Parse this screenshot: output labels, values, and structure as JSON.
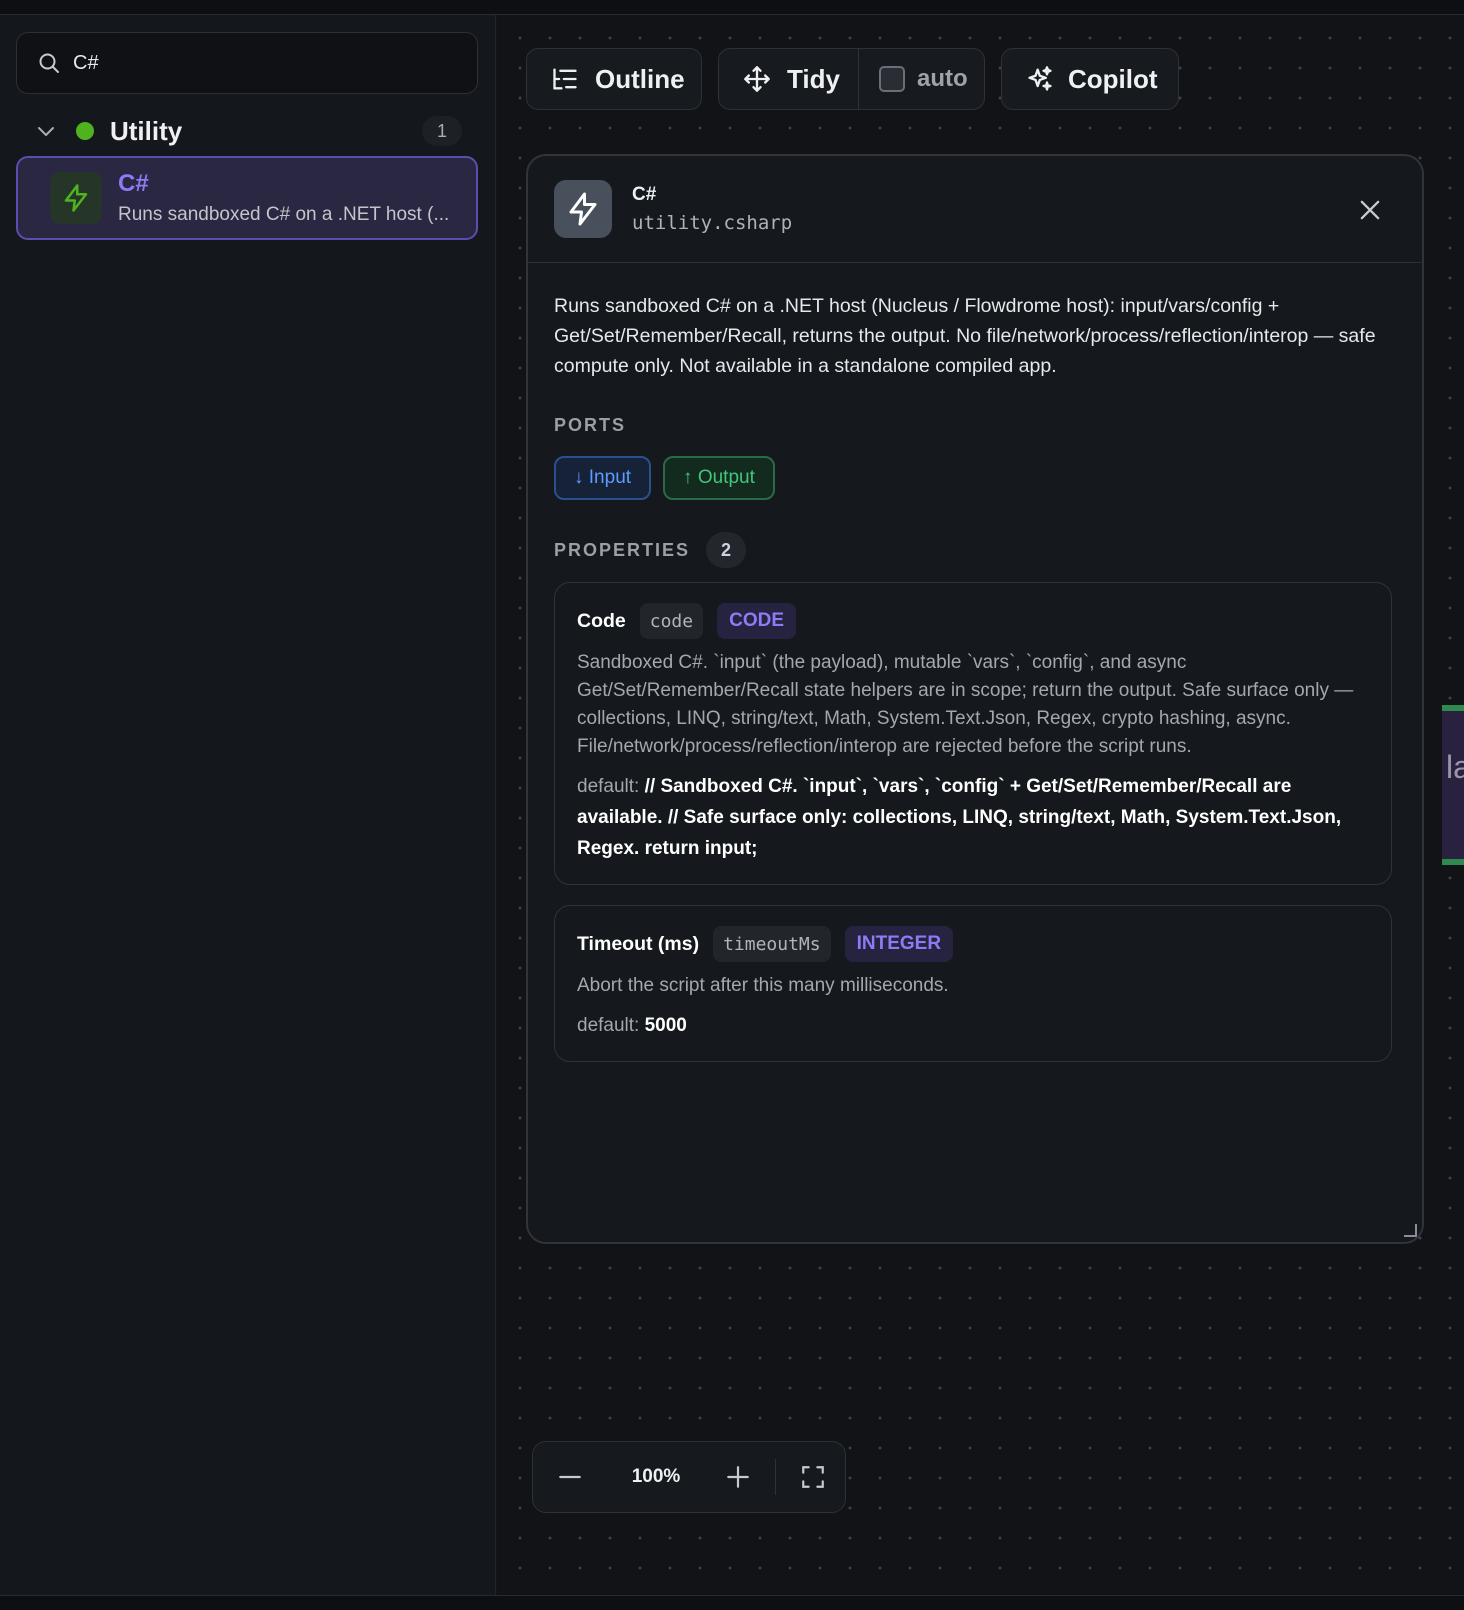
{
  "sidebar": {
    "search": {
      "value": "C#",
      "placeholder": ""
    },
    "group": {
      "label": "Utility",
      "count": "1",
      "status_color": "#4fb320"
    },
    "item": {
      "title": "C#",
      "description": "Runs sandboxed C# on a .NET host (..."
    }
  },
  "toolbar": {
    "outline_label": "Outline",
    "tidy_label": "Tidy",
    "auto_label": "auto",
    "auto_checked": false,
    "copilot_label": "Copilot"
  },
  "panel": {
    "title": "C#",
    "id": "utility.csharp",
    "description": "Runs sandboxed C# on a .NET host (Nucleus / Flowdrome host): input/vars/config + Get/Set/Remember/Recall, returns the output. No file/network/process/reflection/interop — safe compute only. Not available in a standalone compiled app.",
    "ports_label": "PORTS",
    "ports": {
      "input": "↓ Input",
      "output": "↑ Output"
    },
    "properties_label": "PROPERTIES",
    "properties_count": "2",
    "properties": [
      {
        "name": "Code",
        "key": "code",
        "type": "CODE",
        "description": "Sandboxed C#. `input` (the payload), mutable `vars`, `config`, and async Get/Set/Remember/Recall state helpers are in scope; return the output. Safe surface only — collections, LINQ, string/text, Math, System.Text.Json, Regex, crypto hashing, async. File/network/process/reflection/interop are rejected before the script runs.",
        "default_label": "default:",
        "default_value": "// Sandboxed C#. `input`, `vars`, `config` + Get/Set/Remember/Recall are available. // Safe surface only: collections, LINQ, string/text, Math, System.Text.Json, Regex. return input;"
      },
      {
        "name": "Timeout (ms)",
        "key": "timeoutMs",
        "type": "INTEGER",
        "description": "Abort the script after this many milliseconds.",
        "default_label": "default:",
        "default_value": "5000"
      }
    ]
  },
  "zoom": {
    "value": "100%"
  },
  "peek_node": {
    "text": "la"
  },
  "colors": {
    "accent": "#8b7cf6",
    "input_port": "#5e9bff",
    "output_port": "#42c77b",
    "category_green": "#4fb320"
  },
  "icons": [
    "search-icon",
    "chevron-down-icon",
    "lightning-icon",
    "outline-icon",
    "move-icon",
    "sparkles-icon",
    "close-icon",
    "minus-icon",
    "plus-icon",
    "fullscreen-icon",
    "resize-handle-icon"
  ]
}
